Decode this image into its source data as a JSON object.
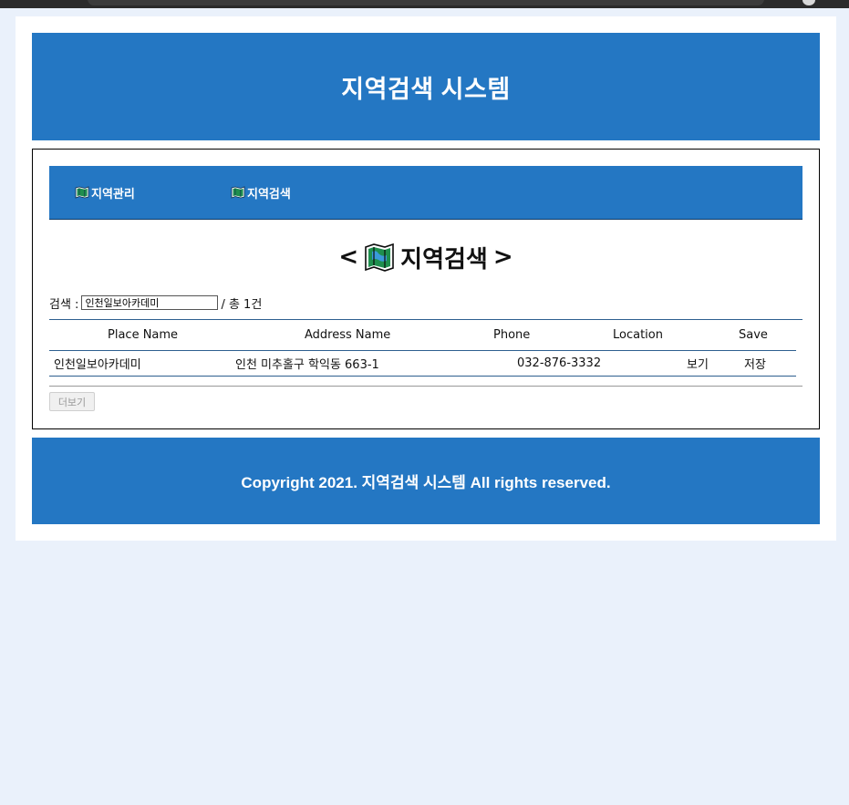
{
  "header": {
    "title": "지역검색 시스템"
  },
  "nav": {
    "items": [
      {
        "label": "지역관리",
        "icon": "map-icon"
      },
      {
        "label": "지역검색",
        "icon": "map-icon"
      }
    ]
  },
  "main": {
    "title_open": "<",
    "title_text": "지역검색",
    "title_close": ">",
    "title_icon": "map-icon"
  },
  "search": {
    "label": "검색 :",
    "value": "인천일보아카데미",
    "result_count": "/ 총 1건"
  },
  "table": {
    "headers": {
      "place_name": "Place Name",
      "address_name": "Address Name",
      "phone": "Phone",
      "location": "Location",
      "save": "Save"
    },
    "rows": [
      {
        "place_name": "인천일보아카데미",
        "address_name": "인천 미추홀구 학익동 663-1",
        "phone": "032-876-3332",
        "location": "보기",
        "save": "저장"
      }
    ]
  },
  "more_button": {
    "label": "더보기"
  },
  "footer": {
    "text": "Copyright 2021. 지역검색 시스템 All rights reserved."
  },
  "colors": {
    "brand_blue": "#2477c3",
    "page_bg": "#eaf1fb",
    "table_line": "#2e5f8f"
  }
}
